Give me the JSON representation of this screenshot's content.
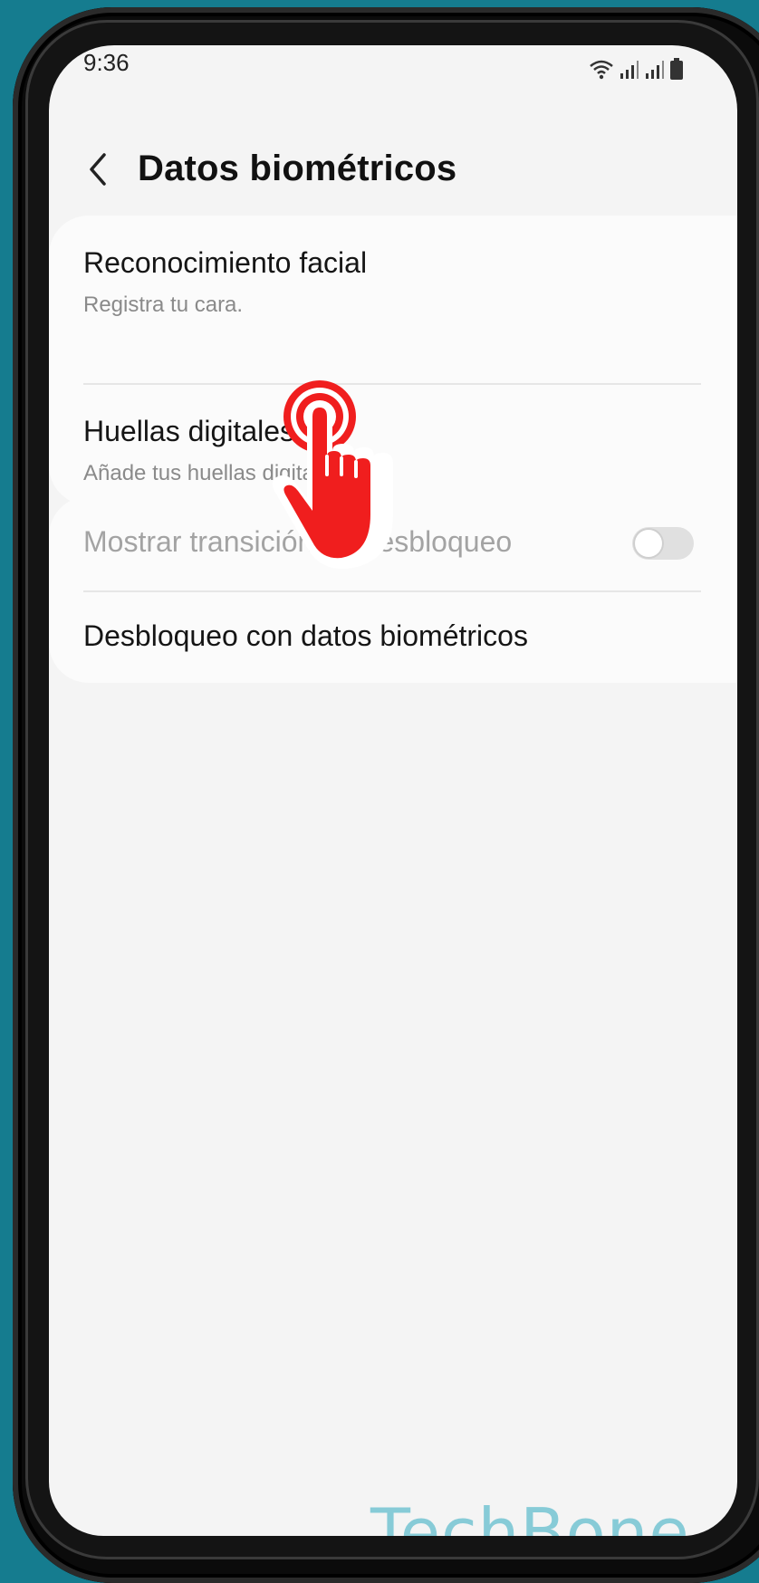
{
  "status_bar": {
    "time": "9:36",
    "icons": [
      "wifi-icon",
      "signal-icon",
      "signal-icon",
      "battery-icon"
    ]
  },
  "header": {
    "back_icon": "chevron-left-icon",
    "title": "Datos biométricos"
  },
  "group1": {
    "items": [
      {
        "title": "Reconocimiento facial",
        "subtitle": "Registra tu cara."
      },
      {
        "title": "Huellas digitales",
        "subtitle": "Añade tus huellas digitales."
      }
    ]
  },
  "group2": {
    "transition": {
      "title": "Mostrar transición de desbloqueo",
      "enabled": false,
      "toggle_on": false
    },
    "unlock": {
      "title": "Desbloqueo con datos biométricos"
    }
  },
  "overlay": {
    "tap_hint_icon": "tap-hand-icon",
    "hand_color": "#f01e1e"
  },
  "watermark": {
    "text": "TechBone",
    "color": "#7cc7d4"
  },
  "colors": {
    "background": "#157c8f",
    "screen": "#f4f4f4",
    "card": "#fbfbfb"
  }
}
